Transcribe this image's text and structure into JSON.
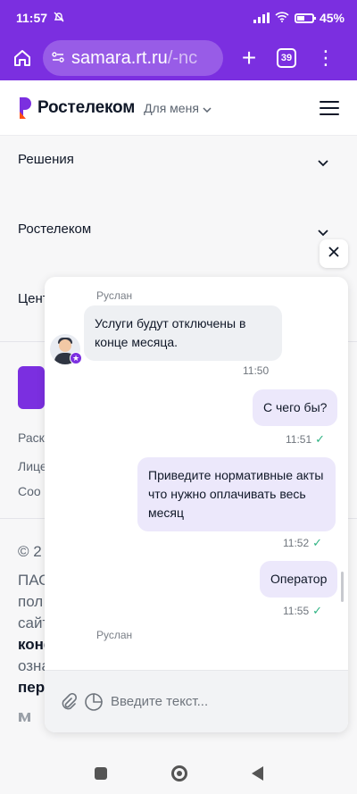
{
  "status_bar": {
    "time": "11:57",
    "battery": "45%",
    "battery_level": 0.45
  },
  "browser": {
    "url_domain": "samara.rt.ru",
    "url_path": "/-nc",
    "tab_count": "39"
  },
  "header": {
    "brand": "Ростелеком",
    "audience": "Для меня",
    "audience_icon": "chevron-down-icon"
  },
  "page": {
    "accordion": [
      "Решения",
      "Ростелеком",
      "Цент"
    ],
    "links": [
      "Раск",
      "Лице",
      "Соо"
    ],
    "copyright": "© 2",
    "footer_lines": [
      "ПАС",
      "пол",
      "сайт",
      "конф",
      "озна",
      "пер"
    ],
    "social": "vk-icon"
  },
  "chat": {
    "close_icon": "close-icon",
    "operator_name": "Руслан",
    "messages": [
      {
        "dir": "in",
        "text": "Услуги будут отключены в конце месяца.",
        "time": "11:50"
      },
      {
        "dir": "out",
        "text": "С чего бы?",
        "time": "11:51"
      },
      {
        "dir": "out",
        "text": "Приведите нормативные акты что нужно оплачивать весь месяц",
        "time": "11:52"
      },
      {
        "dir": "out",
        "text": "Оператор",
        "time": "11:55"
      }
    ],
    "input_placeholder": "Введите текст..."
  },
  "colors": {
    "brand": "#7b2fe0",
    "accent": "#ff4f12",
    "check": "#2fb383"
  }
}
